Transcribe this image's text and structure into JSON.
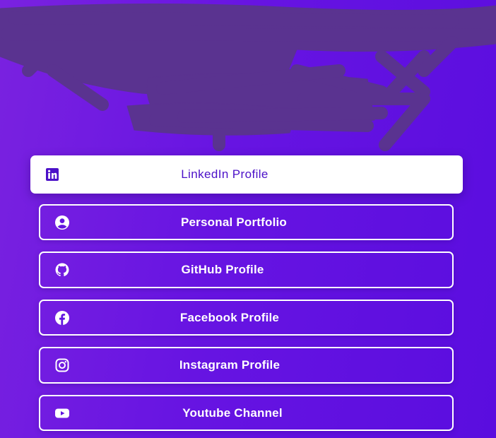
{
  "page": {
    "background_gradient": [
      "#7a22e0",
      "#5a0ddf"
    ],
    "redaction_color": "#5a3390"
  },
  "links": [
    {
      "label": "LinkedIn Profile",
      "icon": "linkedin-icon",
      "active": true
    },
    {
      "label": "Personal Portfolio",
      "icon": "user-circle-icon",
      "active": false
    },
    {
      "label": "GitHub Profile",
      "icon": "github-icon",
      "active": false
    },
    {
      "label": "Facebook Profile",
      "icon": "facebook-icon",
      "active": false
    },
    {
      "label": "Instagram Profile",
      "icon": "instagram-icon",
      "active": false
    },
    {
      "label": "Youtube Channel",
      "icon": "youtube-icon",
      "active": false
    }
  ]
}
